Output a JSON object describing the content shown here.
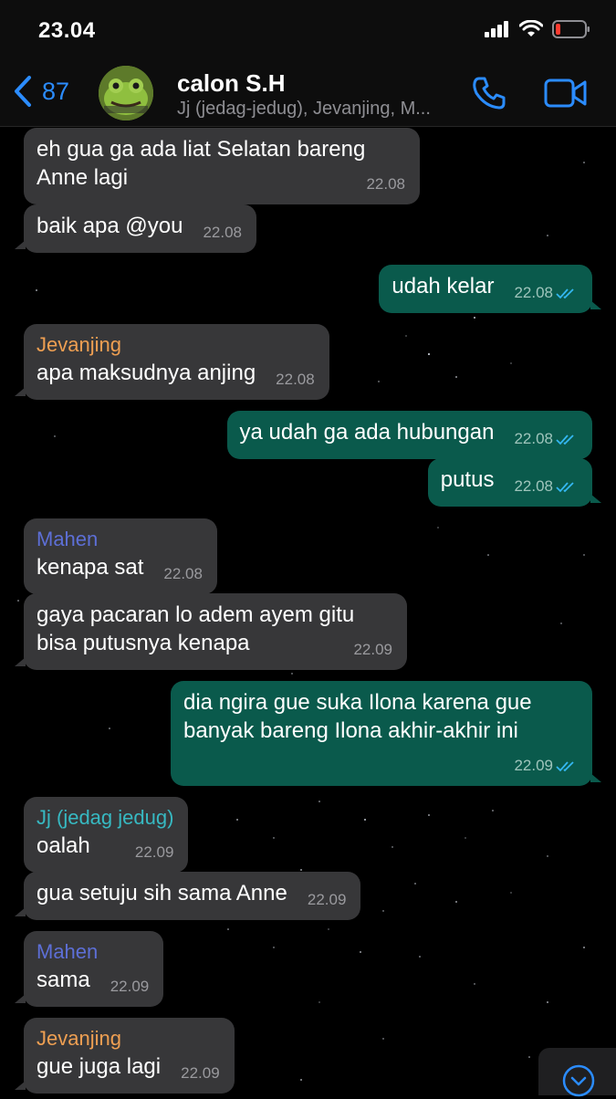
{
  "status": {
    "time": "23.04"
  },
  "header": {
    "back_count": "87",
    "title": "calon S.H",
    "subtitle": "Jj (jedag-jedug), Jevanjing, M..."
  },
  "colors": {
    "sender_jevanjing": "#ee9f52",
    "sender_mahen": "#5d6fd6",
    "sender_jj": "#37b9c2",
    "incoming_bubble": "#373739",
    "outgoing_bubble": "#0a5a4c",
    "tick": "#34b7f1"
  },
  "messages": [
    {
      "text": "eh gua ga ada liat Selatan bareng Anne lagi",
      "time": "22.08",
      "direction": "in"
    },
    {
      "text": "baik apa @you",
      "time": "22.08",
      "direction": "in"
    },
    {
      "text": "udah kelar",
      "time": "22.08",
      "direction": "out",
      "status": "read"
    },
    {
      "sender": "Jevanjing",
      "text": "apa maksudnya anjing",
      "time": "22.08",
      "direction": "in"
    },
    {
      "text": "ya udah ga ada hubungan",
      "time": "22.08",
      "direction": "out",
      "status": "read"
    },
    {
      "text": "putus",
      "time": "22.08",
      "direction": "out",
      "status": "read"
    },
    {
      "sender": "Mahen",
      "text": "kenapa sat",
      "time": "22.08",
      "direction": "in"
    },
    {
      "text": "gaya pacaran lo adem ayem gitu bisa putusnya kenapa",
      "time": "22.09",
      "direction": "in"
    },
    {
      "text": "dia ngira gue suka Ilona karena gue banyak bareng Ilona akhir-akhir ini",
      "time": "22.09",
      "direction": "out",
      "status": "read"
    },
    {
      "sender": "Jj (jedag jedug)",
      "text": "oalah",
      "time": "22.09",
      "direction": "in"
    },
    {
      "text": "gua setuju sih sama Anne",
      "time": "22.09",
      "direction": "in"
    },
    {
      "sender": "Mahen",
      "text": "sama",
      "time": "22.09",
      "direction": "in"
    },
    {
      "sender": "Jevanjing",
      "text": "gue juga lagi",
      "time": "22.09",
      "direction": "in"
    }
  ],
  "icons": {
    "back": "chevron-left-icon",
    "call": "phone-icon",
    "video": "video-camera-icon",
    "scroll": "chevron-down-circle-icon",
    "read_ticks": "double-check-icon"
  }
}
